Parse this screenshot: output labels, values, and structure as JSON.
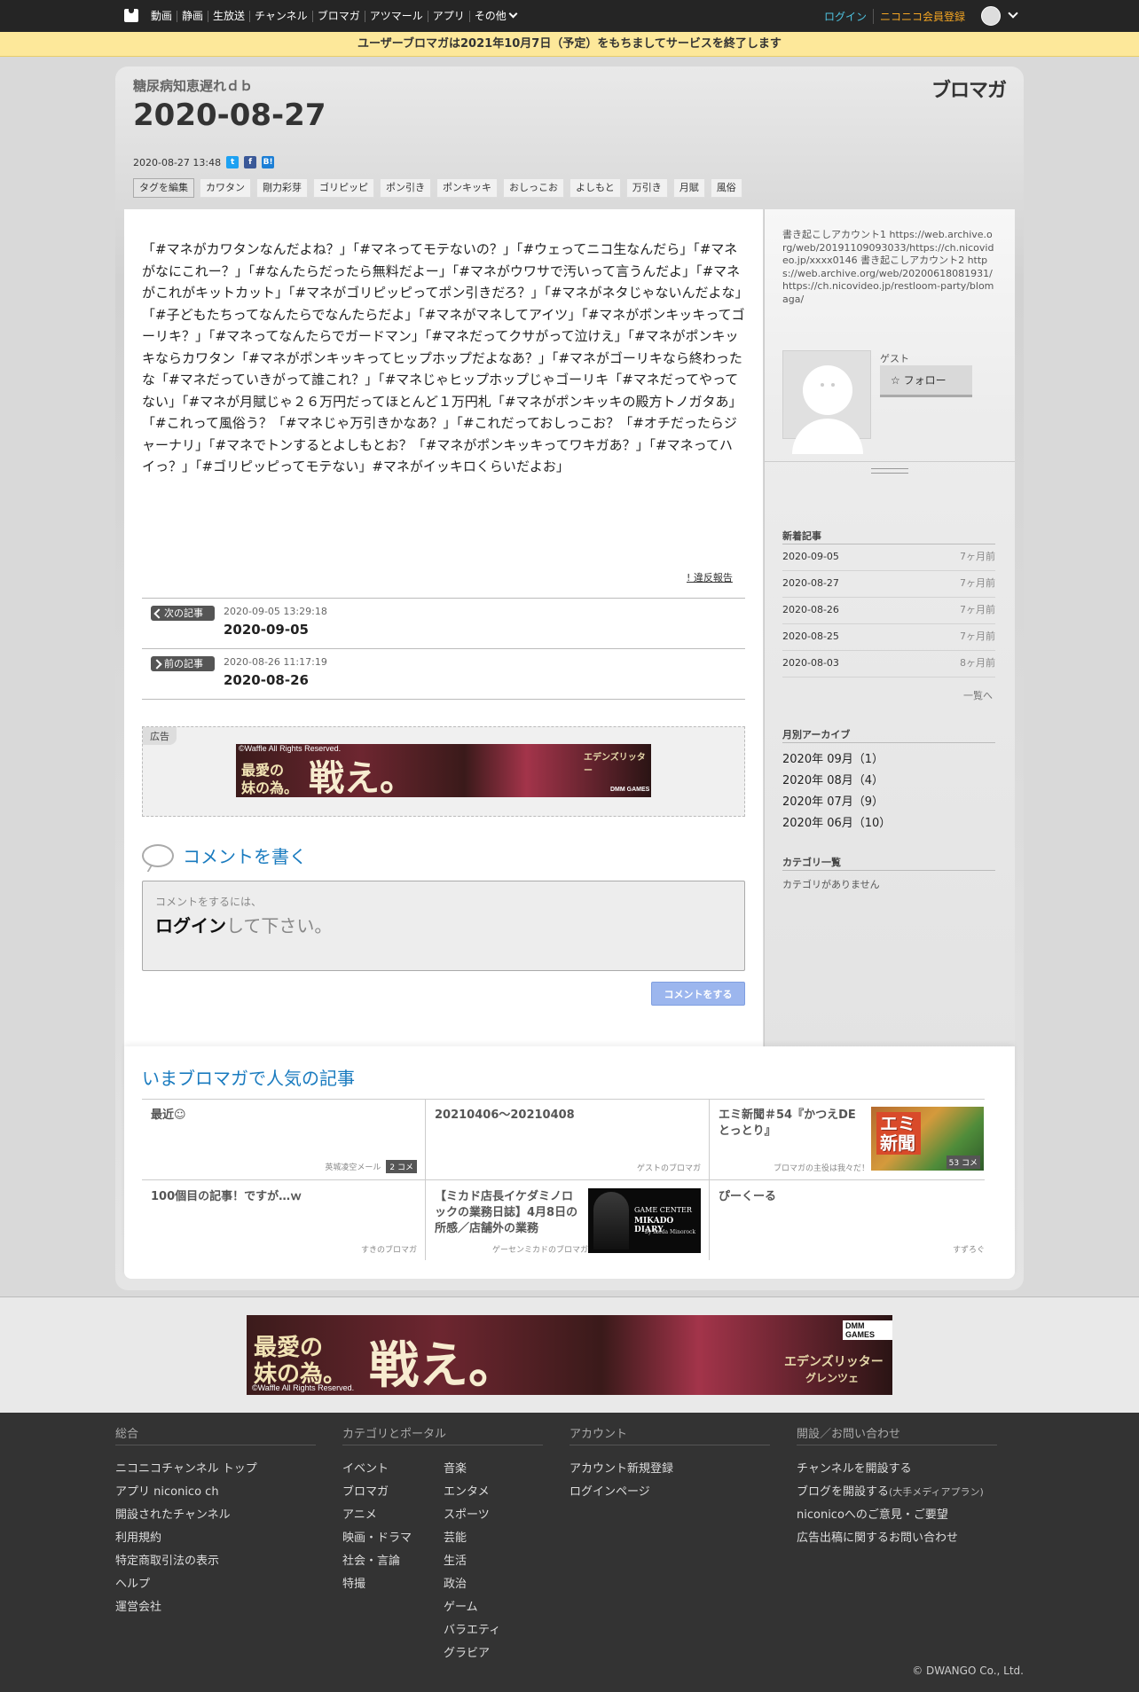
{
  "topbar": {
    "nav": [
      "動画",
      "静画",
      "生放送",
      "チャンネル",
      "ブロマガ",
      "アツマール",
      "アプリ",
      "その他"
    ],
    "login": "ログイン",
    "register": "ニコニコ会員登録"
  },
  "notice": "ユーザーブロマガは2021年10月7日（予定）をもちましてサービスを終了します",
  "blog": {
    "name": "糖尿病知恵遅れｄｂ",
    "brand": "ブロマガ"
  },
  "article": {
    "title": "2020-08-27",
    "datetime": "2020-08-27 13:48",
    "tags_edit": "タグを編集",
    "tags": [
      "カワタン",
      "剛力彩芽",
      "ゴリピッピ",
      "ポン引き",
      "ポンキッキ",
      "おしっこお",
      "よしもと",
      "万引き",
      "月賦",
      "風俗"
    ],
    "body": "「#マネがカワタンなんだよね？」「#マネってモテないの？」「#ウェってニコ生なんだら」「#マネがなにこれー？」「#なんたらだったら無料だよー」「#マネがウワサで汚いって言うんだよ」「#マネがこれがキットカット」「#マネがゴリピッピってポン引きだろ？」「#マネがネタじゃないんだよな」「#子どもたちってなんたらでなんたらだよ」「#マネがマネしてアイツ」「#マネがポンキッキってゴーリキ？」「#マネってなんたらでガードマン」「#マネだってクサがって泣けえ」「#マネがポンキッキならカワタン「#マネがポンキッキってヒップホップだよなあ？」「#マネがゴーリキなら終わったな「#マネだっていきがって誰これ？」「#マネじゃヒップホップじゃゴーリキ「#マネだってやってない」「#マネが月賦じゃ２６万円だってほとんど１万円札「#マネがポンキッキの殿方トノガタあ」「#これって風俗う？「#マネじゃ万引きかなあ？」「#これだっておしっこお？「#オチだったらジャーナリ」「#マネでトンするとよしもとお？「#マネがポンキッキってワキガあ？」「#マネってハイっ？」「#ゴリピッピってモテない」#マネがイッキロくらいだよお」",
    "report": "! 違反報告",
    "next_label": "次の記事",
    "next_date": "2020-09-05 13:29:18",
    "next_title": "2020-09-05",
    "prev_label": "前の記事",
    "prev_date": "2020-08-26 11:17:19",
    "prev_title": "2020-08-26"
  },
  "ad": {
    "label": "広告",
    "copyright": "©Waffle All Rights Reserved.",
    "line1": "最愛の",
    "line2": "妹の為。",
    "big": "戦え。",
    "game": "エデンズリッター",
    "game2": "グレンツェ",
    "maker": "DMM GAMES"
  },
  "comment": {
    "heading": "コメントを書く",
    "hint": "コメントをするには、",
    "login": "ログイン",
    "suffix": "して下さい。",
    "button": "コメントをする"
  },
  "sidebar": {
    "description": "書き起こしアカウント1 https://web.archive.org/web/20191109093033/https://ch.nicovideo.jp/xxxx0146 書き起こしアカウント2 https://web.archive.org/web/20200618081931/https://ch.nicovideo.jp/restloom-party/blomaga/",
    "guest": "ゲスト",
    "follow": "フォロー",
    "recent_heading": "新着記事",
    "recent": [
      {
        "date": "2020-09-05",
        "ago": "7ヶ月前"
      },
      {
        "date": "2020-08-27",
        "ago": "7ヶ月前"
      },
      {
        "date": "2020-08-26",
        "ago": "7ヶ月前"
      },
      {
        "date": "2020-08-25",
        "ago": "7ヶ月前"
      },
      {
        "date": "2020-08-03",
        "ago": "8ヶ月前"
      }
    ],
    "more": "一覧へ",
    "archive_heading": "月別アーカイブ",
    "archive": [
      "2020年 09月（1）",
      "2020年 08月（4）",
      "2020年 07月（9）",
      "2020年 06月（10）"
    ],
    "category_heading": "カテゴリ一覧",
    "no_category": "カテゴリがありません"
  },
  "popular": {
    "heading": "いまブロマガで人気の記事",
    "items": [
      {
        "title": "最近☺",
        "source": "英城凌空メール",
        "comments": "2 コメ"
      },
      {
        "title": "20210406～20210408",
        "source": "ゲストのブロマガ"
      },
      {
        "title": "エミ新聞＃54『かつえDEとっとり』",
        "source": "ブロマガの主役は我々だ！",
        "comments": "53 コメ",
        "thumb": "エミ新聞"
      },
      {
        "title": "100個目の記事！ですが…ｗ",
        "source": "すきのブロマガ"
      },
      {
        "title": "【ミカド店長イケダミノロックの業務日誌】4月8日の所感／店舗外の業務",
        "source": "ゲーセンミカドのブロマガ",
        "thumb1": "GAME CENTER",
        "thumb2": "MIKADO DIARY",
        "thumb3": "by Ikeda Minorock"
      },
      {
        "title": "ぴーくーる",
        "source": "すずろぐ"
      }
    ]
  },
  "footer": {
    "cols": [
      {
        "heading": "総合",
        "links": [
          "ニコニコチャンネル トップ",
          "アプリ niconico ch",
          "開設されたチャンネル",
          "利用規約",
          "特定商取引法の表示",
          "ヘルプ",
          "運営会社"
        ]
      },
      {
        "heading": "カテゴリとポータル",
        "links": [
          "イベント",
          "ブロマガ",
          "アニメ",
          "映画・ドラマ",
          "社会・言論",
          "特撮"
        ],
        "links2": [
          "音楽",
          "エンタメ",
          "スポーツ",
          "芸能",
          "生活",
          "政治",
          "ゲーム",
          "バラエティ",
          "グラビア"
        ]
      },
      {
        "heading": "アカウント",
        "links": [
          "アカウント新規登録",
          "ログインページ"
        ]
      },
      {
        "heading": "開設／お問い合わせ",
        "links": [
          "チャンネルを開設する",
          "ブログを開設する",
          "niconicoへのご意見・ご要望",
          "広告出稿に関するお問い合わせ"
        ],
        "small": "(大手メディアプラン)"
      }
    ],
    "copyright": "© DWANGO Co., Ltd."
  },
  "colors": {
    "accent": "#1a7bbf",
    "notice_bg": "#fde89a",
    "topbar": "#252525",
    "login": "#4ec2e0",
    "register": "#f5a623",
    "footer": "#333333"
  }
}
